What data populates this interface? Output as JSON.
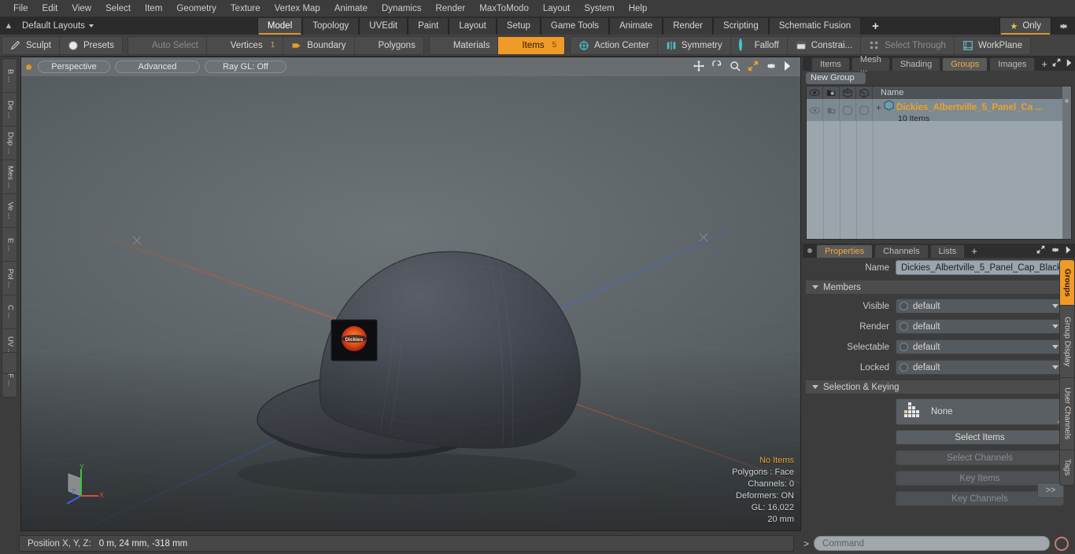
{
  "menu": {
    "items": [
      "File",
      "Edit",
      "View",
      "Select",
      "Item",
      "Geometry",
      "Texture",
      "Vertex Map",
      "Animate",
      "Dynamics",
      "Render",
      "MaxToModo",
      "Layout",
      "System",
      "Help"
    ]
  },
  "layout_bar": {
    "home_icon": "home-icon",
    "layouts_label": "Default Layouts",
    "tabs": [
      {
        "label": "Model",
        "active": true
      },
      {
        "label": "Topology",
        "active": false
      },
      {
        "label": "UVEdit",
        "active": false
      },
      {
        "label": "Paint",
        "active": false
      },
      {
        "label": "Layout",
        "active": false
      },
      {
        "label": "Setup",
        "active": false
      },
      {
        "label": "Game Tools",
        "active": false
      },
      {
        "label": "Animate",
        "active": false
      },
      {
        "label": "Render",
        "active": false
      },
      {
        "label": "Scripting",
        "active": false
      },
      {
        "label": "Schematic Fusion",
        "active": false
      }
    ],
    "add_label": "+",
    "only_label": "Only",
    "star_icon": "star-icon",
    "gear_icon": "gear-icon",
    "accent_color": "#d9952d"
  },
  "toolbar": {
    "groups": [
      {
        "buttons": [
          {
            "label": "Sculpt",
            "icon": "pencil-icon",
            "state": "normal",
            "count": ""
          },
          {
            "label": "Presets",
            "icon": "sphere-icon",
            "state": "normal",
            "count": ""
          }
        ]
      },
      {
        "buttons": [
          {
            "label": "Auto Select",
            "icon": "cube-gray-icon",
            "state": "disabled",
            "count": ""
          },
          {
            "label": "Vertices",
            "icon": "cube-blue-icon",
            "state": "normal",
            "count": "1"
          },
          {
            "label": "Boundary",
            "icon": "boundary-icon",
            "state": "normal",
            "count": ""
          },
          {
            "label": "Polygons",
            "icon": "cube-blue-icon",
            "state": "normal",
            "count": ""
          }
        ]
      },
      {
        "buttons": [
          {
            "label": "Materials",
            "icon": "cube-blue-icon",
            "state": "normal",
            "count": ""
          },
          {
            "label": "Items",
            "icon": "cube-orange-icon",
            "state": "selected",
            "count": "5"
          }
        ]
      },
      {
        "buttons": [
          {
            "label": "Action Center",
            "icon": "action-center-icon",
            "state": "normal",
            "count": ""
          },
          {
            "label": "Symmetry",
            "icon": "symmetry-icon",
            "state": "normal",
            "count": ""
          },
          {
            "label": "Falloff",
            "icon": "falloff-icon",
            "state": "normal",
            "count": ""
          },
          {
            "label": "Constrai...",
            "icon": "constraint-icon",
            "state": "normal",
            "count": ""
          },
          {
            "label": "Select Through",
            "icon": "select-through-icon",
            "state": "disabled",
            "count": ""
          },
          {
            "label": "WorkPlane",
            "icon": "workplane-icon",
            "state": "normal",
            "count": ""
          }
        ]
      }
    ]
  },
  "left_tabs": {
    "items": [
      "B ...",
      "De ...",
      "Dup ...",
      "Mes ...",
      "Ve ...",
      "E ...",
      "Pol ...",
      "C ...",
      "UV ...",
      "F ..."
    ]
  },
  "viewport": {
    "header": {
      "view_mode": "Perspective",
      "shading": "Advanced",
      "raygl": "Ray GL: Off",
      "icons": [
        "move-icon",
        "rotate-icon",
        "zoom-icon",
        "fit-icon",
        "gear-icon",
        "chevron-right-icon"
      ]
    },
    "stats": {
      "items": "No Items",
      "polygons": "Polygons : Face",
      "channels": "Channels: 0",
      "deformers": "Deformers: ON",
      "gl": "GL: 16,022",
      "scale": "20 mm"
    },
    "gizmo": {
      "x": "X",
      "y": "Y",
      "z": "Z"
    },
    "model_name": "Dickies Albertville 5 Panel Cap",
    "background_color": "#5c6367",
    "x_axis_color": "#c8603f",
    "z_axis_color": "#3f63c8"
  },
  "right_panel": {
    "top_tabs": [
      {
        "label": "Items",
        "active": false
      },
      {
        "label": "Mesh ...",
        "active": false
      },
      {
        "label": "Shading",
        "active": false
      },
      {
        "label": "Groups",
        "active": true
      },
      {
        "label": "Images",
        "active": false
      }
    ],
    "top_tab_plus": "+",
    "new_group_label": "New Group",
    "group_list": {
      "columns": [
        "visible-eye-icon",
        "render-icon",
        "cube-wire-icon",
        "cube-shade-icon"
      ],
      "name_header": "Name",
      "rows": [
        {
          "name": "Dickies_Albertville_5_Panel_Ca ...",
          "subtitle": "10 Items",
          "expander": "+"
        }
      ]
    },
    "properties": {
      "tabs": [
        {
          "label": "Properties",
          "active": true
        },
        {
          "label": "Channels",
          "active": false
        },
        {
          "label": "Lists",
          "active": false
        }
      ],
      "tab_plus": "+",
      "name_label": "Name",
      "name_value": "Dickies_Albertville_5_Panel_Cap_Black",
      "sections": [
        {
          "title": "Members",
          "fields": [
            {
              "label": "Visible",
              "value": "default"
            },
            {
              "label": "Render",
              "value": "default"
            },
            {
              "label": "Selectable",
              "value": "default"
            },
            {
              "label": "Locked",
              "value": "default"
            }
          ]
        },
        {
          "title": "Selection & Keying",
          "selector_value": "None",
          "buttons": [
            {
              "label": "Select Items",
              "enabled": true
            },
            {
              "label": "Select Channels",
              "enabled": false
            },
            {
              "label": "Key Items",
              "enabled": false
            },
            {
              "label": "Key Channels",
              "enabled": false
            }
          ],
          "more_label": ">>"
        }
      ]
    },
    "side_tabs": [
      {
        "label": "Groups",
        "active": true
      },
      {
        "label": "Group Display",
        "active": false
      },
      {
        "label": "User Channels",
        "active": false
      },
      {
        "label": "Tags",
        "active": false
      }
    ]
  },
  "status_bar": {
    "position_label": "Position X, Y, Z:",
    "position_value": "0 m, 24 mm, -318 mm",
    "command_prompt": ">",
    "command_placeholder": "Command",
    "record_icon": "record-icon"
  }
}
